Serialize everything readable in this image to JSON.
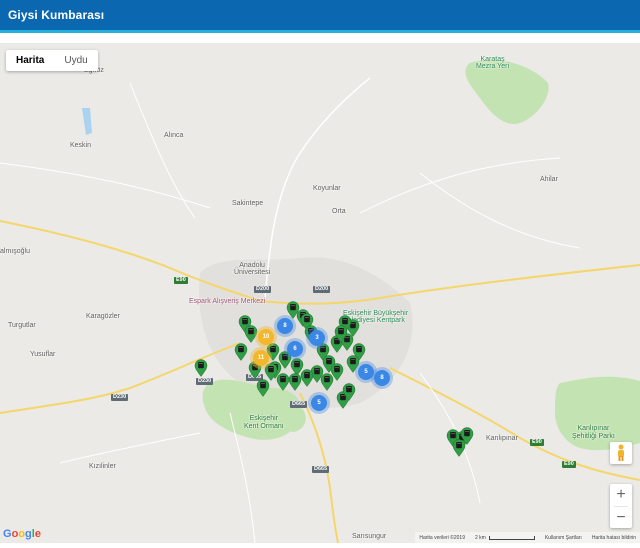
{
  "app": {
    "title": "Giysi Kumbarası"
  },
  "map_type": {
    "map_label": "Harita",
    "satellite_label": "Uydu",
    "selected": "Harita"
  },
  "places": {
    "egrioz": "Eğriöz",
    "karatas": "Karataş\nMezra Yeri",
    "alinca": "Alınca",
    "keskin": "Keskin",
    "koyunlar": "Koyunlar",
    "ahilar": "Ahilar",
    "sakintepe": "Sakintepe",
    "orta": "Orta",
    "almisoglu": "almışoğlu",
    "anadolu": "Anadolu\nÜniversitesi",
    "espark": "Espark Alışveriş Merkezi",
    "buyuksehir": "Eskişehir Büyükşehir\nBelediyesi Kentpark",
    "karagozler": "Karagözler",
    "turgutlar": "Turgutlar",
    "yusuflar": "Yusuflar",
    "kent_ormani": "Eskişehir\nKent Ormanı",
    "kanlipinar": "Kanlıpınar",
    "kanlipinar_sehitligi": "Kanlıpınar\nŞehitliği Parkı",
    "kizilinler": "Kızılinler",
    "sarisungur": "Sarısungur"
  },
  "roads": {
    "e90_west": "E90",
    "e90_east": "E90",
    "d200_a": "D200",
    "d200_b": "D200",
    "d230_a": "D230",
    "d230_b": "D230",
    "d665_a": "D665",
    "d665_b": "D665",
    "d665_c": "D665",
    "e90_mid": "E90"
  },
  "clusters": [
    {
      "count": "10",
      "color": "yellow"
    },
    {
      "count": "11",
      "color": "yellow"
    },
    {
      "count": "8",
      "color": "blue"
    },
    {
      "count": "6",
      "color": "blue"
    },
    {
      "count": "3",
      "color": "blue"
    },
    {
      "count": "5",
      "color": "blue"
    },
    {
      "count": "8",
      "color": "blue"
    },
    {
      "count": "5",
      "color": "blue"
    }
  ],
  "controls": {
    "zoom_in": "+",
    "zoom_out": "−"
  },
  "google": {
    "logo": [
      "G",
      "o",
      "o",
      "g",
      "l",
      "e"
    ]
  },
  "attribution": {
    "map_data": "Harita verileri ©2019",
    "scale": "2 km",
    "terms": "Kullanım Şartları",
    "report": "Harita hatası bildirin"
  },
  "colors": {
    "header": "#0b67b0",
    "header_stripe": "#24b1d9",
    "marker": "#2f9e44",
    "park": "#c4e3b2"
  },
  "icons": {
    "pin": "map-pin-icon",
    "bin": "clothing-bin-icon",
    "pegman": "pegman-icon"
  }
}
